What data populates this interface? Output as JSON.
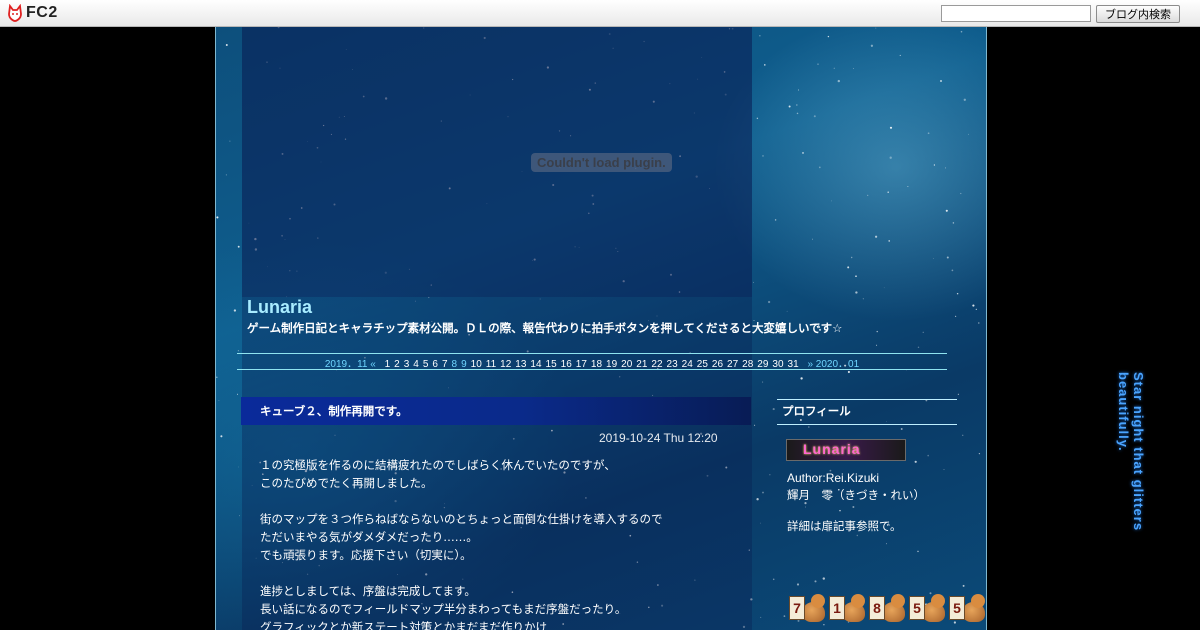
{
  "topbar": {
    "logo_text": "FC2",
    "search_placeholder": "",
    "search_button_label": "ブログ内検索"
  },
  "plugin": {
    "message": "Couldn't load plugin."
  },
  "blog": {
    "title": "Lunaria",
    "description": "ゲーム制作日記とキャラチップ素材公開。ＤＬの際、報告代わりに拍手ボタンを押してくださると大変嬉しいです☆"
  },
  "calendar": {
    "prev_month": "2019．11 «",
    "next_month": "» 2020．01",
    "days": [
      "1",
      "2",
      "3",
      "4",
      "5",
      "6",
      "7",
      "8",
      "9",
      "10",
      "11",
      "12",
      "13",
      "14",
      "15",
      "16",
      "17",
      "18",
      "19",
      "20",
      "21",
      "22",
      "23",
      "24",
      "25",
      "26",
      "27",
      "28",
      "29",
      "30",
      "31"
    ],
    "linked_days": [
      "8",
      "9"
    ]
  },
  "entry": {
    "title": "キューブ２、制作再開です。",
    "date": "2019-10-24 Thu 12:20",
    "lines": [
      "１の究極版を作るのに結構疲れたのでしばらく休んでいたのですが、",
      "このたびめでたく再開しました。",
      "",
      "街のマップを３つ作らねばならないのとちょっと面倒な仕掛けを導入するので",
      "ただいまやる気がダメダメだったり……。",
      "でも頑張ります。応援下さい（切実に）。",
      "",
      "進捗としましては、序盤は完成してます。",
      "長い話になるのでフィールドマップ半分まわってもまだ序盤だったり。",
      "グラフィックとか新ステート対策とかまだまだ作りかけ"
    ]
  },
  "sidebar": {
    "profile_title": "プロフィール",
    "banner_text": "Lunaria",
    "author": "Author:Rei.Kizuki",
    "author_name": "輝月　零（きづき・れい）",
    "author_note": "詳細は扉記事参照で。",
    "counter_digits": [
      "7",
      "1",
      "8",
      "5",
      "5"
    ]
  },
  "decor": {
    "vertical_text": "Star night that glitters beautifully."
  },
  "colors": {
    "title": "#a8ecff",
    "calendar_link": "#6fd6ff",
    "vertical_text": "#4aa4ff"
  }
}
